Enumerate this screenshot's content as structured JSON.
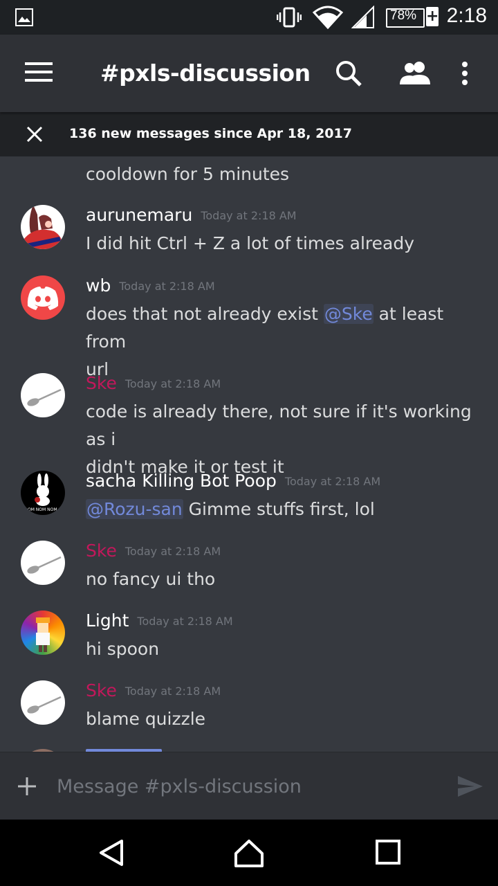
{
  "status_bar": {
    "battery": "78%",
    "time": "2:18"
  },
  "toolbar": {
    "title": "#pxls-discussion"
  },
  "new_messages_bar": {
    "text": "136 new messages since Apr 18, 2017"
  },
  "partial_message": {
    "text": "cooldown for 5 minutes"
  },
  "messages": [
    {
      "username": "aurunemaru",
      "username_color": "#ffffff",
      "timestamp": "Today at 2:18 AM",
      "lines": [
        "I did hit Ctrl + Z a lot of times already"
      ]
    },
    {
      "username": "wb",
      "username_color": "#ffffff",
      "timestamp": "Today at 2:18 AM",
      "text_before": "does that not already exist ",
      "mention": "@Ske",
      "text_after": " at least from",
      "line2": "url"
    },
    {
      "username": "Ske",
      "username_color": "#c2185b",
      "timestamp": "Today at 2:18 AM",
      "lines": [
        "code is already there, not sure if it's working as i",
        "didn't make it or test it"
      ]
    },
    {
      "username": "sacha Killing Bot Poop",
      "username_color": "#ffffff",
      "timestamp": "Today at 2:18 AM",
      "mention": "@Rozu-san",
      "text_after": " Gimme stuffs first, lol",
      "avatar_caption": "OM NOM NOM"
    },
    {
      "username": "Ske",
      "username_color": "#c2185b",
      "timestamp": "Today at 2:18 AM",
      "lines": [
        "no fancy ui tho"
      ]
    },
    {
      "username": "Light",
      "username_color": "#ffffff",
      "timestamp": "Today at 2:18 AM",
      "lines": [
        "hi spoon"
      ]
    },
    {
      "username": "Ske",
      "username_color": "#c2185b",
      "timestamp": "Today at 2:18 AM",
      "lines": [
        "blame quizzle"
      ]
    }
  ],
  "input": {
    "placeholder": "Message #pxls-discussion"
  },
  "colors": {
    "background": "#36393f",
    "toolbar": "#2f3136",
    "mention": "#7289da",
    "discord_red": "#f04747",
    "ske_pink": "#c2185b"
  }
}
